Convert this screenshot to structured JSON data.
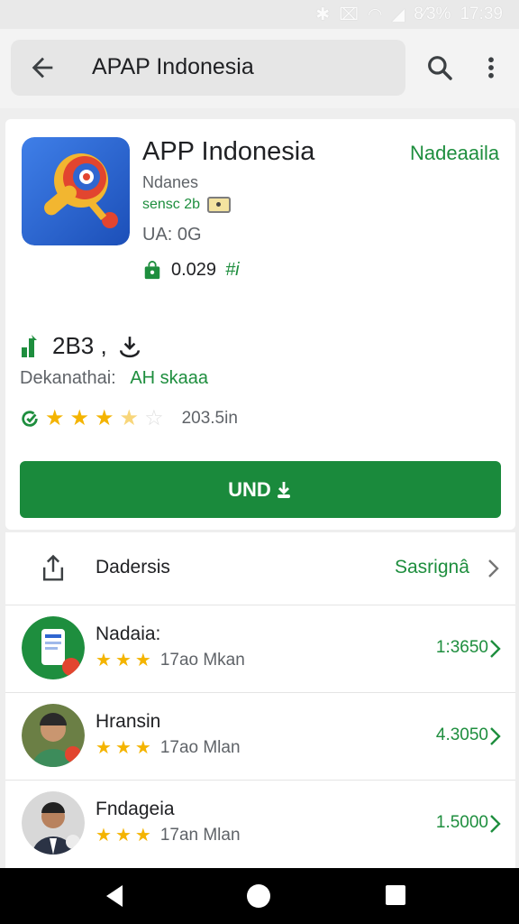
{
  "status_bar": {
    "icons": [
      "bluetooth-icon",
      "vibrate-icon",
      "wifi-icon",
      "signal-icon"
    ],
    "battery": "8⁄3%",
    "time": "17:39"
  },
  "search_bar": {
    "title": "APAP Indonesia"
  },
  "app": {
    "name": "APP Indonesia",
    "install_state": "Nadeaaila",
    "developer": "Ndanes",
    "rating_meta": "sensc 2b",
    "size": "UA: 0G",
    "price": "0.029",
    "price_suffix": "#i",
    "downloads": "2B3 ,",
    "category_label": "Dekanathai:",
    "category_link": "AH skaaa",
    "rating_value": 3.5,
    "review_count": "203.5in",
    "install_button": "UND"
  },
  "share_row": {
    "label": "Dadersis",
    "action": "Sasrignâ"
  },
  "related_apps": [
    {
      "name": "Nadaia:",
      "stars": 3,
      "subtitle": "17ao Mkan",
      "price": "1:3650"
    },
    {
      "name": "Hransin",
      "stars": 3,
      "subtitle": "17ao Mlan",
      "price": "4.3050"
    },
    {
      "name": "Fndageia",
      "stars": 3,
      "subtitle": "17an Mlan",
      "price": "1.5000"
    }
  ],
  "colors": {
    "accent": "#1a8a3c",
    "text_green": "#1e8e3e",
    "star": "#f4b400",
    "nav_bar": "#000000"
  }
}
